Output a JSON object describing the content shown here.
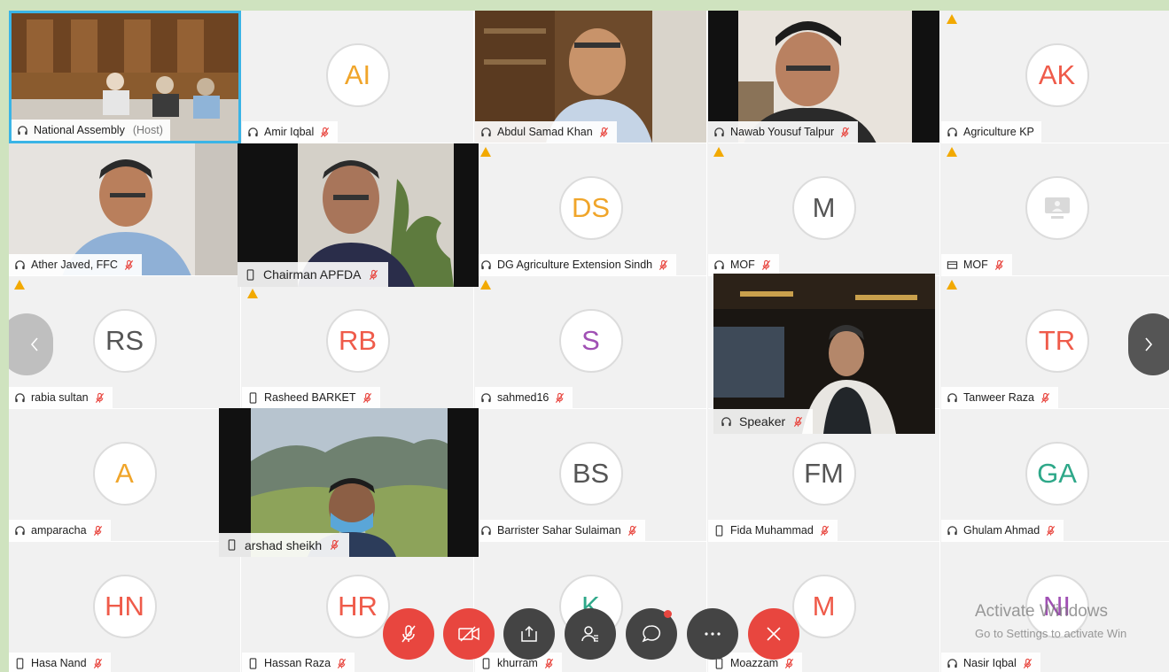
{
  "colors": {
    "frame": "#cfe3bf",
    "tile": "#f1f1f1",
    "mute": "#e8463f",
    "control_dark": "#444444",
    "active_border": "#3ab4e6",
    "warning": "#f2a900"
  },
  "video_tiles": [
    {
      "id": "national-assembly",
      "name": "National Assembly",
      "host": "(Host)",
      "device": "headset"
    },
    {
      "id": "abdul-samad-khan",
      "name": "Abdul Samad Khan",
      "device": "headset"
    },
    {
      "id": "nawab-yousuf-talpur",
      "name": "Nawab Yousuf Talpur",
      "device": "headset"
    },
    {
      "id": "ather-javed",
      "name": "Ather Javed, FFC",
      "device": "headset"
    },
    {
      "id": "chairman-apfda",
      "name": "Chairman APFDA",
      "device": "phone"
    },
    {
      "id": "speaker",
      "name": "Speaker",
      "device": "headset"
    },
    {
      "id": "arshad-sheikh",
      "name": "arshad sheikh",
      "device": "phone"
    }
  ],
  "avatar_tiles": [
    {
      "id": "amir-iqbal",
      "initials": "AI",
      "name": "Amir Iqbal",
      "color": "#f0a52a",
      "device": "headset",
      "warning": false
    },
    {
      "id": "agriculture-kp",
      "initials": "AK",
      "name": "Agriculture KP",
      "color": "#ef5b4a",
      "device": "headset",
      "warning": true
    },
    {
      "id": "dg-agri-sindh",
      "initials": "DS",
      "name": "DG Agriculture Extension Sindh",
      "color": "#f0a52a",
      "device": "headset",
      "warning": true
    },
    {
      "id": "mof-1",
      "initials": "M",
      "name": "MOF",
      "color": "#555555",
      "device": "headset",
      "warning": true
    },
    {
      "id": "mof-2",
      "initials": "",
      "name": "MOF",
      "color": "#aaaaaa",
      "device": "room",
      "warning": true
    },
    {
      "id": "rabia-sultan",
      "initials": "RS",
      "name": "rabia sultan",
      "color": "#555555",
      "device": "headset",
      "warning": true
    },
    {
      "id": "rasheed-barket",
      "initials": "RB",
      "name": "Rasheed BARKET",
      "color": "#ef5b4a",
      "device": "phone",
      "warning": true
    },
    {
      "id": "sahmed16",
      "initials": "S",
      "name": "sahmed16",
      "color": "#a050b4",
      "device": "headset",
      "warning": true
    },
    {
      "id": "tanweer-raza",
      "initials": "TR",
      "name": "Tanweer Raza",
      "color": "#ef5b4a",
      "device": "headset",
      "warning": true
    },
    {
      "id": "amparacha",
      "initials": "A",
      "name": "amparacha",
      "color": "#f0a52a",
      "device": "headset",
      "warning": false
    },
    {
      "id": "barrister-sahar",
      "initials": "BS",
      "name": "Barrister Sahar Sulaiman",
      "color": "#555555",
      "device": "headset",
      "warning": false
    },
    {
      "id": "fida-muhammad",
      "initials": "FM",
      "name": "Fida Muhammad",
      "color": "#555555",
      "device": "phone",
      "warning": false
    },
    {
      "id": "ghulam-ahmad",
      "initials": "GA",
      "name": "Ghulam Ahmad",
      "color": "#2ea889",
      "device": "headset",
      "warning": false
    },
    {
      "id": "hasa-nand",
      "initials": "HN",
      "name": "Hasa Nand",
      "color": "#ef5b4a",
      "device": "phone",
      "warning": false
    },
    {
      "id": "hassan-raza",
      "initials": "HR",
      "name": "Hassan Raza",
      "color": "#ef5b4a",
      "device": "phone",
      "warning": false
    },
    {
      "id": "khurram",
      "initials": "K",
      "name": "khurram",
      "color": "#2ea889",
      "device": "phone",
      "warning": false
    },
    {
      "id": "moazzam",
      "initials": "M",
      "name": "Moazzam",
      "color": "#ef5b4a",
      "device": "phone",
      "warning": false
    },
    {
      "id": "nasir-iqbal",
      "initials": "NI",
      "name": "Nasir Iqbal",
      "color": "#a050b4",
      "device": "headset",
      "warning": false
    }
  ],
  "controls": [
    {
      "id": "mute",
      "icon": "mic-off-icon",
      "color": "#e8463f"
    },
    {
      "id": "video",
      "icon": "video-off-icon",
      "color": "#e8463f"
    },
    {
      "id": "share",
      "icon": "share-icon",
      "color": "#444444"
    },
    {
      "id": "participants",
      "icon": "participants-icon",
      "color": "#444444"
    },
    {
      "id": "chat",
      "icon": "chat-icon",
      "color": "#444444"
    },
    {
      "id": "more",
      "icon": "more-icon",
      "color": "#444444"
    },
    {
      "id": "leave",
      "icon": "close-icon",
      "color": "#e8463f"
    }
  ],
  "watermark": {
    "line1": "Activate Windows",
    "line2": "Go to Settings to activate Win"
  }
}
